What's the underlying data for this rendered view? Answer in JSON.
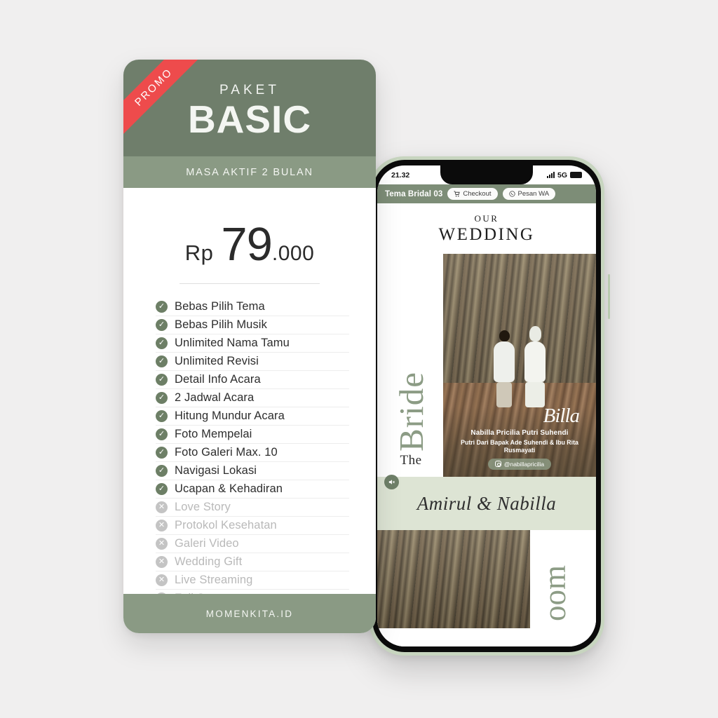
{
  "background_color": "#f0efef",
  "card": {
    "ribbon_label": "PROMO",
    "paket_label": "PAKET",
    "paket_name": "BASIC",
    "validity": "MASA AKTIF 2 BULAN",
    "price": {
      "currency": "Rp",
      "amount": "79",
      "decimals": ".000"
    },
    "features": [
      {
        "label": "Bebas Pilih Tema",
        "included": true,
        "icon": "check-icon"
      },
      {
        "label": "Bebas Pilih Musik",
        "included": true,
        "icon": "check-icon"
      },
      {
        "label": "Unlimited Nama Tamu",
        "included": true,
        "icon": "check-icon"
      },
      {
        "label": "Unlimited Revisi",
        "included": true,
        "icon": "check-icon"
      },
      {
        "label": "Detail Info Acara",
        "included": true,
        "icon": "check-icon"
      },
      {
        "label": "2 Jadwal Acara",
        "included": true,
        "icon": "check-icon"
      },
      {
        "label": "Hitung Mundur Acara",
        "included": true,
        "icon": "check-icon"
      },
      {
        "label": "Foto Mempelai",
        "included": true,
        "icon": "check-icon"
      },
      {
        "label": "Foto Galeri Max. 10",
        "included": true,
        "icon": "check-icon"
      },
      {
        "label": "Navigasi Lokasi",
        "included": true,
        "icon": "check-icon"
      },
      {
        "label": "Ucapan & Kehadiran",
        "included": true,
        "icon": "check-icon"
      },
      {
        "label": "Love Story",
        "included": false,
        "icon": "cross-icon"
      },
      {
        "label": "Protokol Kesehatan",
        "included": false,
        "icon": "cross-icon"
      },
      {
        "label": "Galeri Video",
        "included": false,
        "icon": "cross-icon"
      },
      {
        "label": "Wedding Gift",
        "included": false,
        "icon": "cross-icon"
      },
      {
        "label": "Live Streaming",
        "included": false,
        "icon": "cross-icon"
      },
      {
        "label": "Full Support",
        "included": false,
        "icon": "cross-icon"
      }
    ],
    "footer_brand": "MOMENKITA.ID",
    "colors": {
      "header_green": "#6f7e6b",
      "strip_green": "#8a9a84",
      "promo_red": "#ee4b4c",
      "check_green": "#6d7f66",
      "cross_gray": "#c4c4c4"
    }
  },
  "phone": {
    "frame_color": "#c7d5bf",
    "statusbar": {
      "time": "21.32",
      "network": "5G",
      "signal_icon": "signal-bars-icon",
      "battery_icon": "battery-icon"
    },
    "appbar": {
      "title": "Tema Bridal 03",
      "checkout_label": "Checkout",
      "checkout_icon": "cart-icon",
      "wa_label": "Pesan WA",
      "wa_icon": "whatsapp-icon",
      "bg_color": "#7d8d77"
    },
    "invitation": {
      "eyebrow": "OUR",
      "title": "WEDDING",
      "bride_section": {
        "small_word": "The",
        "big_word": "Bride",
        "signature": "Billa",
        "full_name": "Nabilla Pricilia Putri Suhendi",
        "parents": "Putri Dari Bapak Ade Suhendi & Ibu Rita Rusmayati",
        "instagram": "@nabillapricilia",
        "mute_icon": "speaker-mute-icon"
      },
      "couple_names": "Amirul & Nabilla",
      "names_band_color": "#dde4d4",
      "groom_section": {
        "big_word": "oom"
      }
    }
  }
}
